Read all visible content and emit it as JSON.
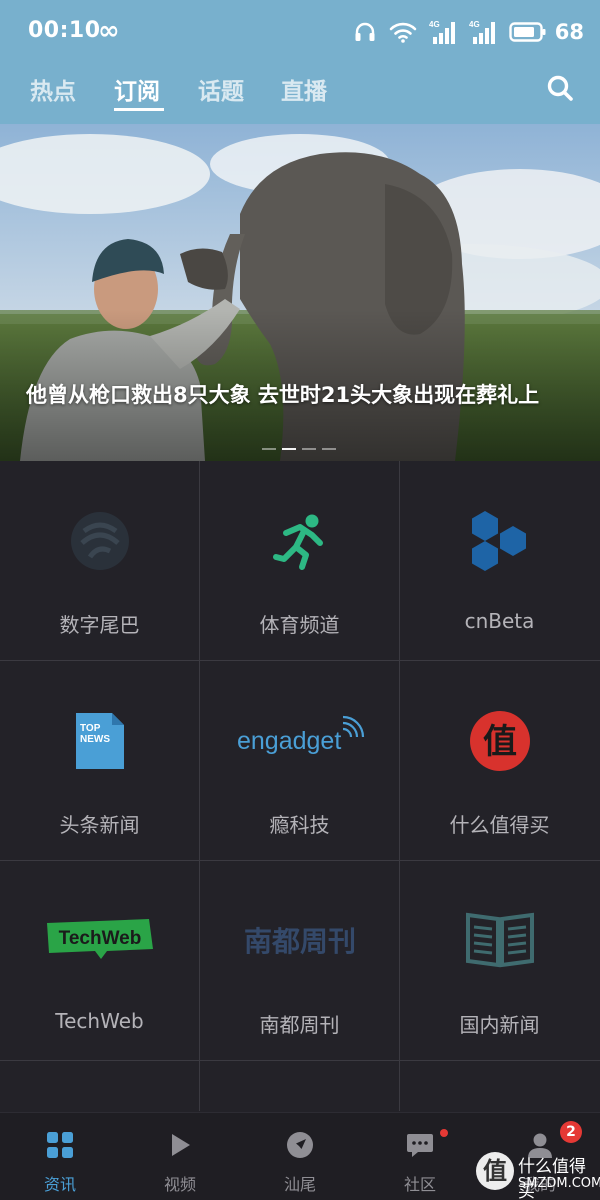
{
  "status_bar": {
    "time": "00:10",
    "loop_symbol": "∞",
    "network_label_1": "4G",
    "network_label_2": "4G",
    "battery": "68"
  },
  "tabs": [
    {
      "label": "热点",
      "active": false
    },
    {
      "label": "订阅",
      "active": true
    },
    {
      "label": "话题",
      "active": false
    },
    {
      "label": "直播",
      "active": false
    }
  ],
  "banner": {
    "title": "他曾从枪口救出8只大象 去世时21头大象出现在葬礼上",
    "dot_count": 4,
    "active_dot": 1
  },
  "channels": [
    {
      "label": "数字尾巴",
      "icon": "digital-tail-icon"
    },
    {
      "label": "体育频道",
      "icon": "running-man-icon"
    },
    {
      "label": "cnBeta",
      "icon": "hexagons-icon"
    },
    {
      "label": "头条新闻",
      "icon": "top-news-icon",
      "icon_text_1": "TOP",
      "icon_text_2": "NEWS"
    },
    {
      "label": "瘾科技",
      "icon": "engadget-icon",
      "icon_text": "engadget"
    },
    {
      "label": "什么值得买",
      "icon": "smzdm-icon",
      "icon_text": "值"
    },
    {
      "label": "TechWeb",
      "icon": "techweb-icon",
      "icon_text": "TechWeb"
    },
    {
      "label": "南都周刊",
      "icon": "nandu-icon",
      "icon_text": "南都周刊"
    },
    {
      "label": "国内新闻",
      "icon": "open-book-icon"
    }
  ],
  "bottom_nav": [
    {
      "label": "资讯",
      "icon": "grid-icon",
      "active": true
    },
    {
      "label": "视频",
      "icon": "play-icon",
      "active": false
    },
    {
      "label": "汕尾",
      "icon": "compass-icon",
      "active": false
    },
    {
      "label": "社区",
      "icon": "chat-icon",
      "active": false,
      "dot": true
    },
    {
      "label": "我的",
      "icon": "user-icon",
      "active": false,
      "badge": "2"
    }
  ],
  "watermark": {
    "logo_text": "值",
    "text": "什么值得买",
    "domain": "SMZDM.COM"
  },
  "colors": {
    "header_bg": "#78b0cd",
    "grid_bg": "#232228",
    "active_blue": "#4a9fd6",
    "badge_red": "#e53935"
  }
}
